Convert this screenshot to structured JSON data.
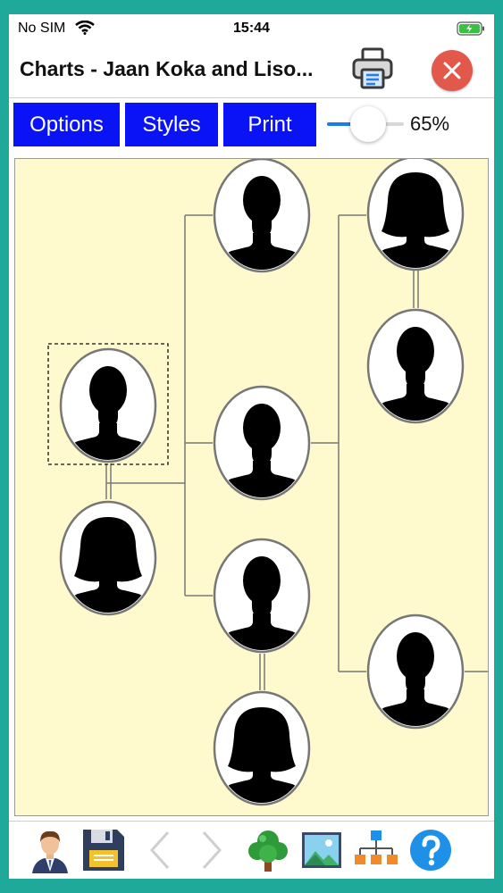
{
  "status": {
    "carrier": "No SIM",
    "time": "15:44"
  },
  "header": {
    "title": "Charts - Jaan Koka and Liso..."
  },
  "toolbar": {
    "options_label": "Options",
    "styles_label": "Styles",
    "print_label": "Print",
    "zoom_label": "65%"
  },
  "zoom": {
    "level": 0.65
  },
  "chart": {
    "background": "#fffacd",
    "line_color": "#777777",
    "selected_person": "root-male"
  },
  "colors": {
    "button_blue": "#0a13f5",
    "close_red": "#e2584a",
    "frame_teal": "#1fa99a",
    "slider_blue": "#1a7cf5"
  },
  "icons": {
    "bottom": [
      "person-profile-icon",
      "save-floppy-icon",
      "back-arrow-icon",
      "forward-arrow-icon",
      "tree-icon",
      "picture-icon",
      "hierarchy-icon",
      "help-icon"
    ]
  }
}
